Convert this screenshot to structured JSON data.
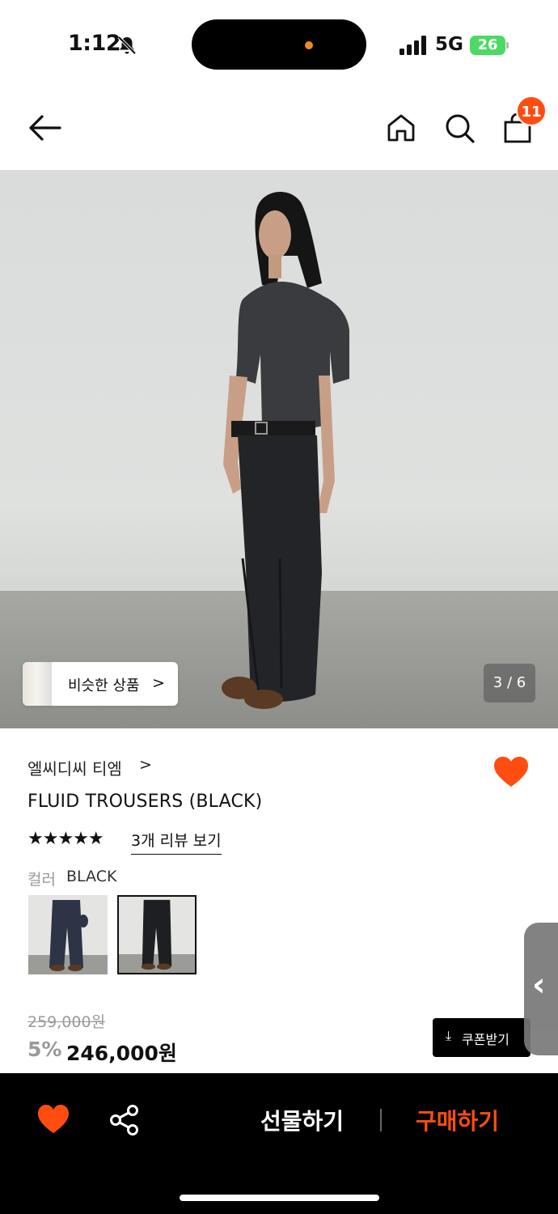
{
  "status_bar": {
    "time": "1:12",
    "network": "5G",
    "battery": "26"
  },
  "header": {
    "cart_count": "11",
    "icons": [
      "back-arrow-icon",
      "home-icon",
      "search-icon",
      "shopping-bag-icon"
    ]
  },
  "hero": {
    "similar_label": "비슷한 상품",
    "similar_chevron": ">",
    "page_indicator": "3 / 6"
  },
  "product": {
    "brand": "엘씨디씨 티엠",
    "brand_chevron": ">",
    "title": "FLUID TROUSERS (BLACK)",
    "stars": "★★★★★",
    "rating": 5,
    "review_link": "3개 리뷰 보기",
    "color_label": "컬러",
    "color_value": "BLACK",
    "original_price": "259,000원",
    "discount": "5%",
    "sale_price": "246,000원",
    "coupon_icon": "⤓",
    "coupon_label": "쿠폰받기",
    "favorite_active": true
  },
  "bottom_bar": {
    "gift_label": "선물하기",
    "buy_label": "구매하기"
  },
  "colors": {
    "accent": "#ff4d12",
    "heart": "#ff4d12",
    "battery": "#4cd964"
  }
}
